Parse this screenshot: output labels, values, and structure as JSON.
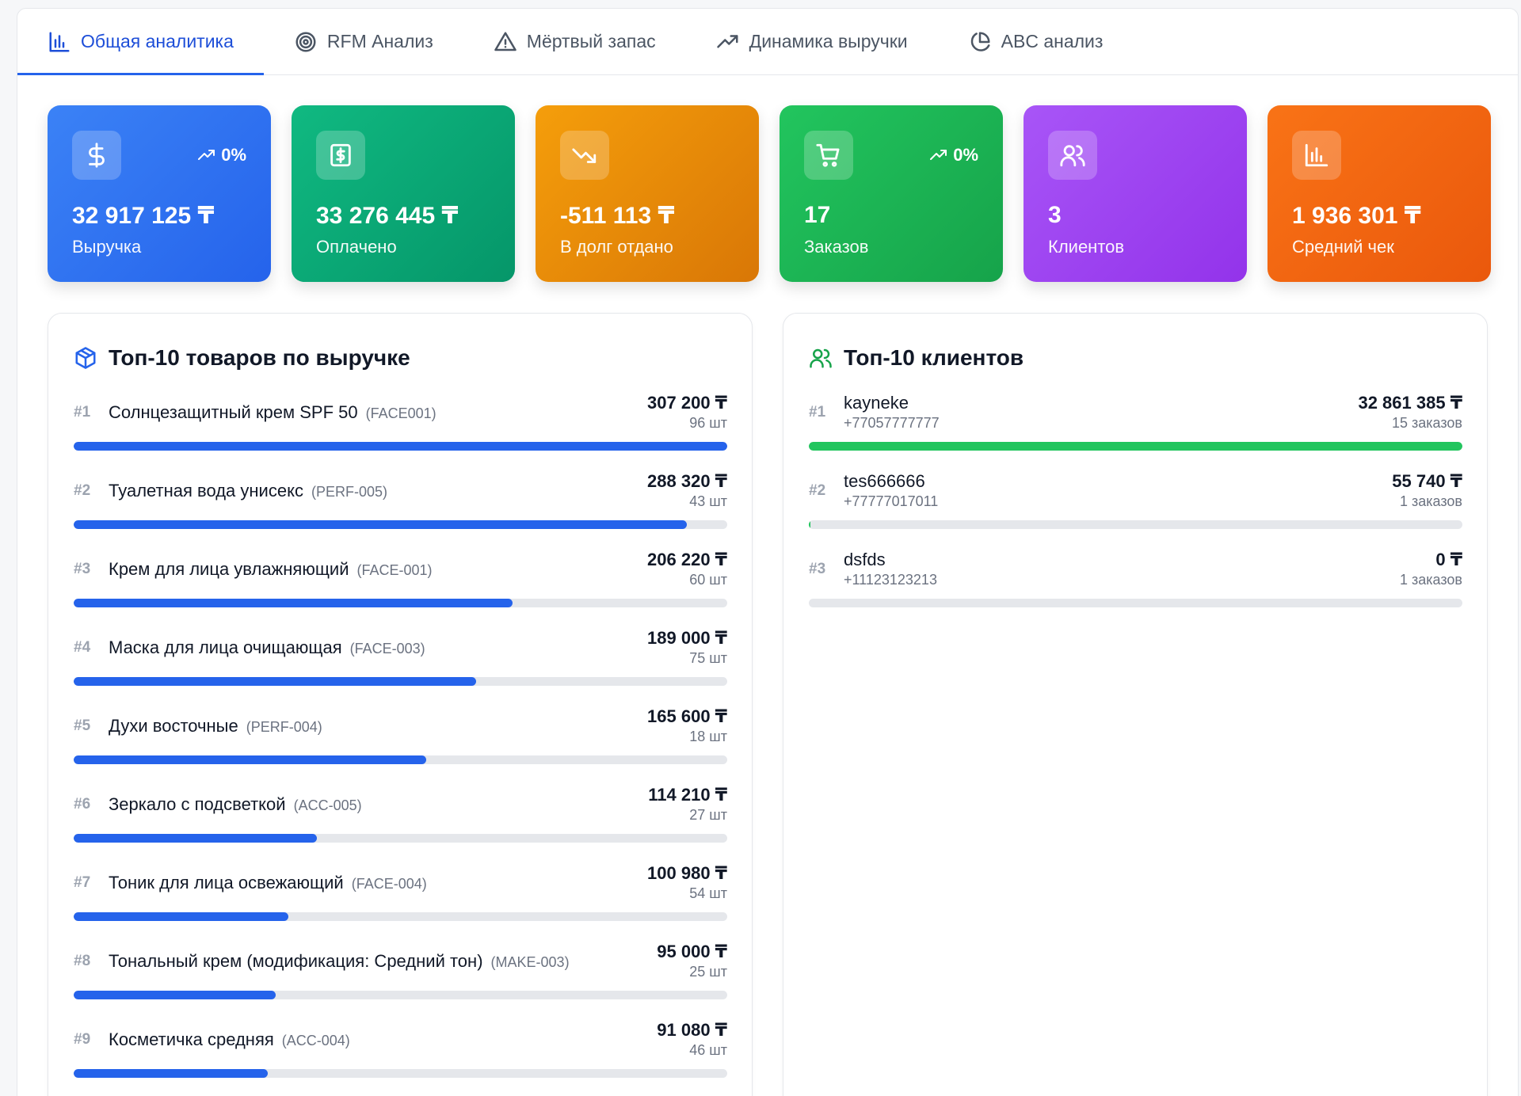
{
  "tabs": [
    {
      "label": "Общая аналитика",
      "icon": "bar-chart-icon",
      "active": true
    },
    {
      "label": "RFM Анализ",
      "icon": "target-icon",
      "active": false
    },
    {
      "label": "Мёртвый запас",
      "icon": "warning-icon",
      "active": false
    },
    {
      "label": "Динамика выручки",
      "icon": "trending-up-icon",
      "active": false
    },
    {
      "label": "ABC анализ",
      "icon": "pie-chart-icon",
      "active": false
    }
  ],
  "cards": [
    {
      "value": "32 917 125 ₸",
      "label": "Выручка",
      "trend": "0%",
      "icon": "dollar-icon",
      "color_from": "#3b82f6",
      "color_to": "#2563eb"
    },
    {
      "value": "33 276 445 ₸",
      "label": "Оплачено",
      "trend": "",
      "icon": "banknote-icon",
      "color_from": "#10b981",
      "color_to": "#059669"
    },
    {
      "value": "-511 113 ₸",
      "label": "В долг отдано",
      "trend": "",
      "icon": "trending-down-icon",
      "color_from": "#f59e0b",
      "color_to": "#d97706"
    },
    {
      "value": "17",
      "label": "Заказов",
      "trend": "0%",
      "icon": "cart-icon",
      "color_from": "#22c55e",
      "color_to": "#16a34a"
    },
    {
      "value": "3",
      "label": "Клиентов",
      "trend": "",
      "icon": "users-icon",
      "color_from": "#a855f7",
      "color_to": "#9333ea"
    },
    {
      "value": "1 936 301 ₸",
      "label": "Средний чек",
      "trend": "",
      "icon": "bar-chart-icon",
      "color_from": "#f97316",
      "color_to": "#ea580c"
    }
  ],
  "products_panel": {
    "title": "Топ-10 товаров по выручке",
    "icon": "box-icon",
    "bar_color": "#2563eb",
    "items": [
      {
        "rank": "#1",
        "name": "Солнцезащитный крем SPF 50",
        "sku": "(FACE001)",
        "amount": "307 200 ₸",
        "qty": "96 шт",
        "value": 307200
      },
      {
        "rank": "#2",
        "name": "Туалетная вода унисекс",
        "sku": "(PERF-005)",
        "amount": "288 320 ₸",
        "qty": "43 шт",
        "value": 288320
      },
      {
        "rank": "#3",
        "name": "Крем для лица увлажняющий",
        "sku": "(FACE-001)",
        "amount": "206 220 ₸",
        "qty": "60 шт",
        "value": 206220
      },
      {
        "rank": "#4",
        "name": "Маска для лица очищающая",
        "sku": "(FACE-003)",
        "amount": "189 000 ₸",
        "qty": "75 шт",
        "value": 189000
      },
      {
        "rank": "#5",
        "name": "Духи восточные",
        "sku": "(PERF-004)",
        "amount": "165 600 ₸",
        "qty": "18 шт",
        "value": 165600
      },
      {
        "rank": "#6",
        "name": "Зеркало с подсветкой",
        "sku": "(ACC-005)",
        "amount": "114 210 ₸",
        "qty": "27 шт",
        "value": 114210
      },
      {
        "rank": "#7",
        "name": "Тоник для лица освежающий",
        "sku": "(FACE-004)",
        "amount": "100 980 ₸",
        "qty": "54 шт",
        "value": 100980
      },
      {
        "rank": "#8",
        "name": "Тональный крем (модификация: Средний тон)",
        "sku": "(MAKE-003)",
        "amount": "95 000 ₸",
        "qty": "25 шт",
        "value": 95000
      },
      {
        "rank": "#9",
        "name": "Косметичка средняя",
        "sku": "(ACC-004)",
        "amount": "91 080 ₸",
        "qty": "46 шт",
        "value": 91080
      }
    ]
  },
  "clients_panel": {
    "title": "Топ-10 клиентов",
    "icon": "users-icon",
    "bar_color": "#22c55e",
    "items": [
      {
        "rank": "#1",
        "name": "kayneke",
        "phone": "+77057777777",
        "amount": "32 861 385 ₸",
        "orders": "15 заказов",
        "value": 32861385
      },
      {
        "rank": "#2",
        "name": "tes666666",
        "phone": "+77777017011",
        "amount": "55 740 ₸",
        "orders": "1 заказов",
        "value": 55740
      },
      {
        "rank": "#3",
        "name": "dsfds",
        "phone": "+11123123213",
        "amount": "0 ₸",
        "orders": "1 заказов",
        "value": 0
      }
    ]
  }
}
